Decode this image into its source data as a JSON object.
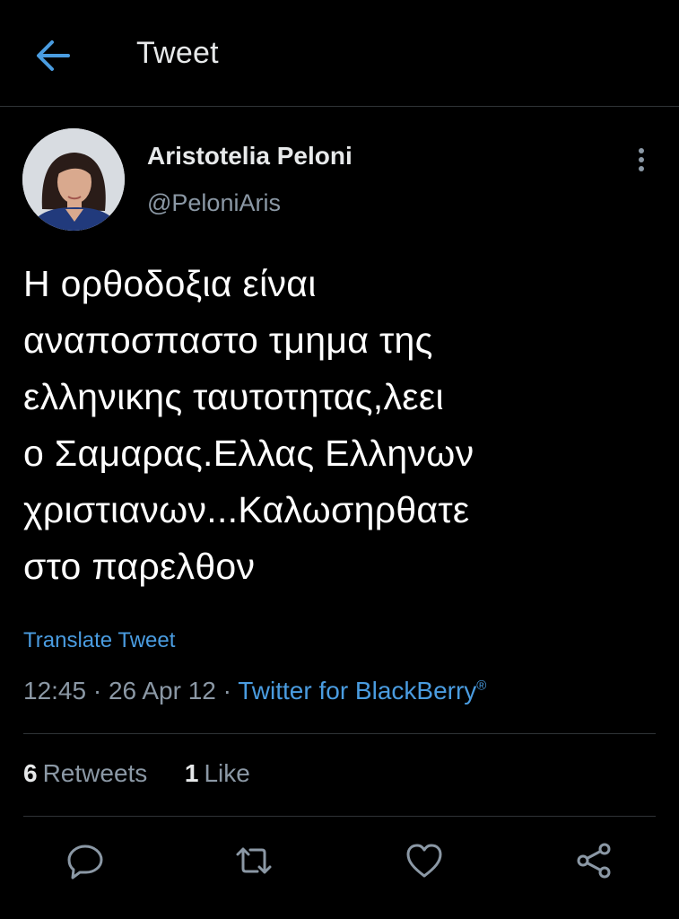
{
  "header": {
    "title": "Tweet",
    "back_icon": "arrow-left-icon",
    "accent": "#4a9ce0"
  },
  "author": {
    "name": "Aristotelia Peloni",
    "handle": "@PeloniAris"
  },
  "tweet": {
    "lines": [
      "Η ορθοδοξια είναι",
      "αναποσπαστο τμημα της",
      "ελληνικης ταυτοτητας,λεει",
      "ο Σαμαρας.Ελλας Ελληνων",
      "χριστιανων...Καλωσηρθατε",
      "στο παρελθον"
    ],
    "translate_label": "Translate Tweet",
    "time": "12:45",
    "separator": " · ",
    "date": "26 Apr 12",
    "source": "Twitter for BlackBerry",
    "source_mark": "®"
  },
  "stats": {
    "retweets_count": "6",
    "retweets_label": "Retweets",
    "likes_count": "1",
    "likes_label": "Like"
  },
  "actions": [
    "reply-icon",
    "retweet-icon",
    "like-icon",
    "share-icon"
  ]
}
